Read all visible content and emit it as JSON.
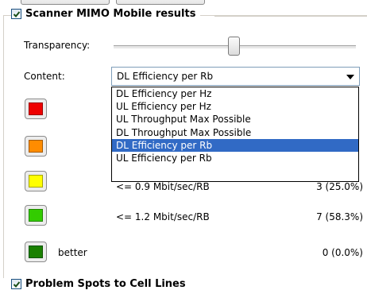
{
  "group": {
    "title": "Scanner MIMO Mobile results",
    "checked": true
  },
  "transparency": {
    "label": "Transparency:",
    "value_percent": 50
  },
  "content": {
    "label": "Content:",
    "selected": "DL Efficiency per Rb",
    "options": [
      "DL Efficiency per Hz",
      "UL Efficiency per Hz",
      "UL Throughput Max Possible",
      "DL Throughput Max Possible",
      "DL Efficiency per Rb",
      "UL Efficiency per Rb"
    ],
    "highlighted_index": 4
  },
  "legend": [
    {
      "color": "#ee0000",
      "range": "",
      "count": ""
    },
    {
      "color": "#ff8c00",
      "range": "",
      "count": ""
    },
    {
      "color": "#ffff00",
      "range": "<= 0.9 Mbit/sec/RB",
      "count": "3 (25.0%)"
    },
    {
      "color": "#33cc00",
      "range": "<= 1.2 Mbit/sec/RB",
      "count": "7 (58.3%)"
    },
    {
      "color": "#1a8000",
      "range": "better",
      "count": "0 (0.0%)"
    }
  ],
  "next_group": {
    "title": "Problem Spots to Cell Lines",
    "checked": true
  }
}
